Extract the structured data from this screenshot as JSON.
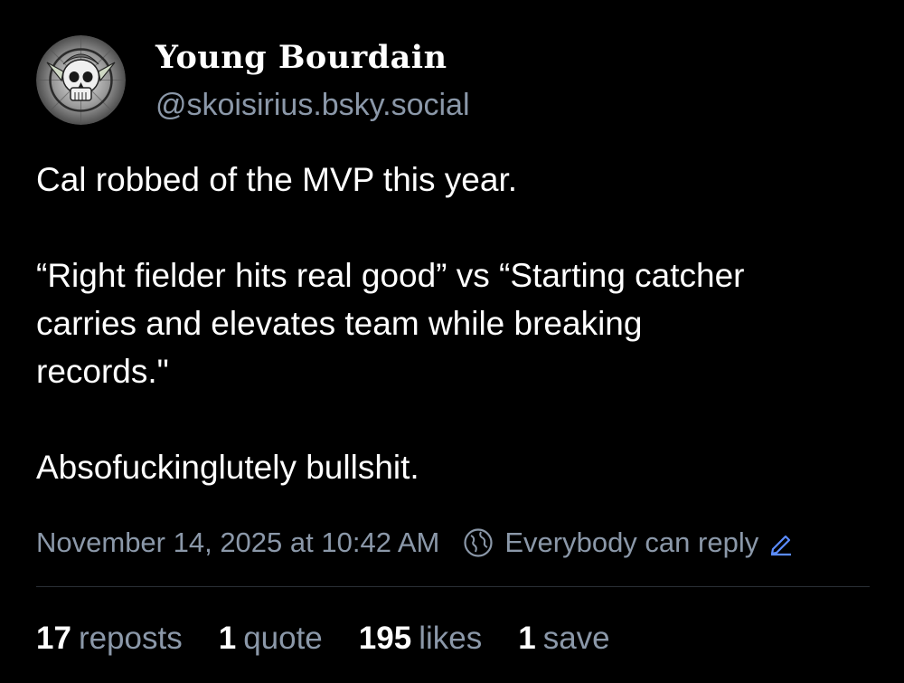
{
  "author": {
    "display_name": "Young Bourdain",
    "handle": "@skoisirius.bsky.social",
    "avatar_icon": "skull-avatar-icon"
  },
  "post": {
    "lines": [
      "Cal robbed of the MVP this year.",
      "“Right fielder hits real good” vs “Starting catcher",
      "carries and elevates team while breaking",
      "records.\"",
      "Absofuckinglutely bullshit."
    ]
  },
  "meta": {
    "timestamp": "November 14, 2025 at 10:42 AM",
    "reply_setting": "Everybody can reply",
    "reply_icon": "globe-icon",
    "edit_icon": "pencil-icon"
  },
  "stats": {
    "reposts_count": "17",
    "reposts_label": "reposts",
    "quotes_count": "1",
    "quotes_label": "quote",
    "likes_count": "195",
    "likes_label": "likes",
    "saves_count": "1",
    "saves_label": "save"
  },
  "colors": {
    "background": "#000000",
    "text": "#ffffff",
    "muted": "#8b98a9",
    "accent": "#5b8cff",
    "divider": "#2a2f36"
  }
}
